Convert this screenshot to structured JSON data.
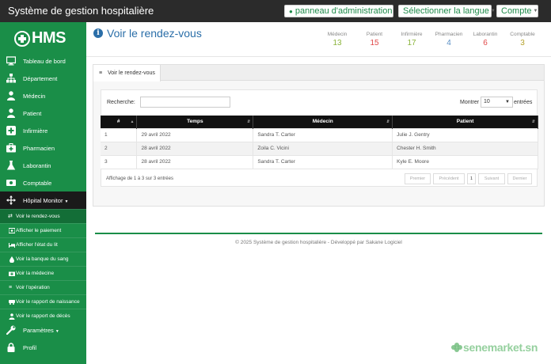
{
  "topbar": {
    "title": "Système de gestion hospitalière",
    "admin_label": "panneau d'administration",
    "language_label": "Sélectionner la langue",
    "account_label": "Compte",
    "admin_icon": "user-icon"
  },
  "logo": {
    "text": "HMS"
  },
  "sidebar": {
    "items": [
      {
        "label": "Tableau de bord",
        "icon": "monitor-icon"
      },
      {
        "label": "Département",
        "icon": "sitemap-icon"
      },
      {
        "label": "Médecin",
        "icon": "doctor-icon"
      },
      {
        "label": "Patient",
        "icon": "user-icon"
      },
      {
        "label": "Infirmière",
        "icon": "plus-square-icon"
      },
      {
        "label": "Pharmacien",
        "icon": "medkit-icon"
      },
      {
        "label": "Laborantin",
        "icon": "flask-icon"
      },
      {
        "label": "Comptable",
        "icon": "money-icon"
      },
      {
        "label": "Hôpital Monitor",
        "icon": "arrows-icon"
      }
    ],
    "sub_items": [
      {
        "label": "Voir le rendez-vous",
        "icon": "exchange-icon"
      },
      {
        "label": "Afficher le paiement",
        "icon": "money-icon"
      },
      {
        "label": "Afficher l'état du lit",
        "icon": "bed-icon"
      },
      {
        "label": "Voir la banque du sang",
        "icon": "tint-icon"
      },
      {
        "label": "Voir la médecine",
        "icon": "medkit-icon"
      },
      {
        "label": "Voir l'opération",
        "icon": "list-icon"
      },
      {
        "label": "Voir le rapport de naissance",
        "icon": "baby-icon"
      },
      {
        "label": "Voir le rapport de décès",
        "icon": "user-icon"
      }
    ],
    "bottom_items": [
      {
        "label": "Paramètres",
        "icon": "wrench-icon"
      },
      {
        "label": "Profil",
        "icon": "lock-icon"
      }
    ]
  },
  "header": {
    "title": "Voir le rendez-vous",
    "stats": [
      {
        "label": "Médecin",
        "value": "13",
        "color": "#8bb43c"
      },
      {
        "label": "Patient",
        "value": "15",
        "color": "#e04a4a"
      },
      {
        "label": "Infirmière",
        "value": "17",
        "color": "#8bb43c"
      },
      {
        "label": "Pharmacien",
        "value": "4",
        "color": "#5a8fc4"
      },
      {
        "label": "Laborantin",
        "value": "6",
        "color": "#e04a4a"
      },
      {
        "label": "Comptable",
        "value": "3",
        "color": "#b5a22e"
      }
    ]
  },
  "panel": {
    "tab_label": "Voir le rendez-vous",
    "search_label": "Recherche:",
    "search_value": "",
    "show_label": "Montrer",
    "show_value": "10",
    "entries_label": "entrées",
    "columns": [
      "#",
      "Temps",
      "Médecin",
      "Patient"
    ],
    "rows": [
      [
        "1",
        "29 avril 2022",
        "Sandra T. Carter",
        "Julie J. Gentry"
      ],
      [
        "2",
        "28 avril 2022",
        "Zoila C. Vicini",
        "Chester H. Smith"
      ],
      [
        "3",
        "28 avril 2022",
        "Sandra T. Carter",
        "Kyle E. Moore"
      ]
    ],
    "info": "Affichage de 1 à 3 sur 3 entrées",
    "pagination": {
      "first": "Premier",
      "prev": "Précédent",
      "current": "1",
      "next": "Suivant",
      "last": "Dernier"
    }
  },
  "footer": {
    "text": "© 2025 Système de gestion hospitalière - Développé par Sakane Logiciel"
  },
  "watermark": {
    "text": "senemarket.sn"
  }
}
